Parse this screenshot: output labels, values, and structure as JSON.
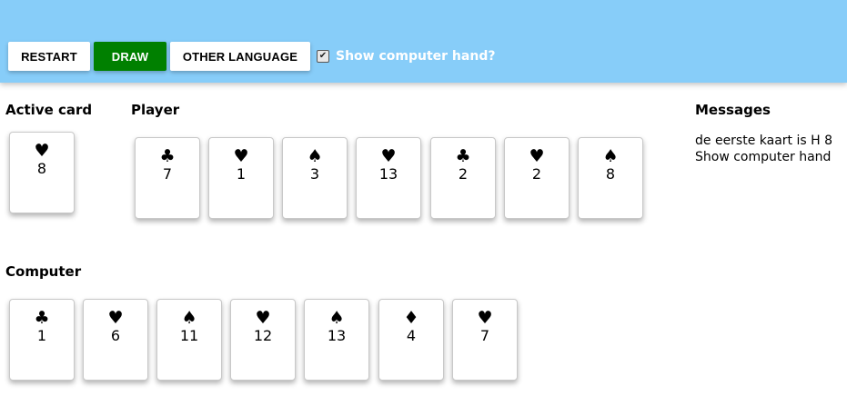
{
  "toolbar": {
    "restart_label": "RESTART",
    "draw_label": "DRAW",
    "language_label": "OTHER LANGUAGE",
    "show_computer_hand_label": "Show computer hand?",
    "show_computer_hand_checked": true
  },
  "active_card": {
    "label": "Active card",
    "suit": "♥",
    "value": "8"
  },
  "player": {
    "label": "Player",
    "cards": [
      {
        "suit": "♣",
        "value": "7"
      },
      {
        "suit": "♥",
        "value": "1"
      },
      {
        "suit": "♠",
        "value": "3"
      },
      {
        "suit": "♥",
        "value": "13"
      },
      {
        "suit": "♣",
        "value": "2"
      },
      {
        "suit": "♥",
        "value": "2"
      },
      {
        "suit": "♠",
        "value": "8"
      }
    ]
  },
  "computer": {
    "label": "Computer",
    "cards": [
      {
        "suit": "♣",
        "value": "1"
      },
      {
        "suit": "♥",
        "value": "6"
      },
      {
        "suit": "♠",
        "value": "11"
      },
      {
        "suit": "♥",
        "value": "12"
      },
      {
        "suit": "♠",
        "value": "13"
      },
      {
        "suit": "♦",
        "value": "4"
      },
      {
        "suit": "♥",
        "value": "7"
      }
    ]
  },
  "messages": {
    "label": "Messages",
    "lines": [
      "de eerste kaart is H 8",
      "Show computer hand"
    ]
  }
}
